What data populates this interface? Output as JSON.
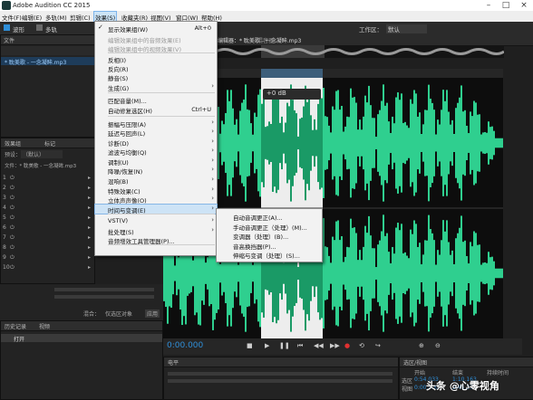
{
  "window": {
    "title": "Adobe Audition CC 2015"
  },
  "menubar": {
    "items": [
      "文件(F)",
      "编辑(E)",
      "多轨(M)",
      "剪辑(C)",
      "效果(S)",
      "收藏夹(R)",
      "视图(V)",
      "窗口(W)",
      "帮助(H)"
    ]
  },
  "toolbar": {
    "waveform": "波形",
    "multitrack": "多轨",
    "workspace_label": "工作区：",
    "workspace_value": "默认"
  },
  "files_panel": {
    "tab": "文件",
    "file_name": "* 耽美歌 - 一念凝眸.mp3"
  },
  "effects_panel": {
    "tab_rack": "效果组",
    "tab_markers": "标记",
    "preset_label": "预设：",
    "preset_value": "（默认）",
    "file_line": "文件：* 耽美歌 - 一念凝眸.mp3",
    "slot_numbers": [
      "1",
      "2",
      "3",
      "4",
      "5",
      "6",
      "7",
      "8",
      "9",
      "10"
    ]
  },
  "history_panel": {
    "tab": "历史记录",
    "tab2": "视频",
    "item": "打开"
  },
  "footer_left": {
    "mix_label": "混合：",
    "mix_value": "仅选区对象",
    "apply": "应用"
  },
  "editor": {
    "tab_label": "编辑器：* 耽美歌 - 一念凝眸.mp3",
    "mixer_tab": "混音器",
    "timecode": "0:00.000",
    "hud_gain": "+0 dB"
  },
  "levels_panel": {
    "tab": "电平"
  },
  "selection_panel": {
    "tab": "选区/视图",
    "col_start": "开始",
    "col_end": "结束",
    "col_duration": "持续时间",
    "row_sel": "选区",
    "row_view": "视图",
    "sel_start": "0:54.033",
    "view_start": "0:00.000",
    "sel_end": "1:10.163",
    "view_end": "2:45.375"
  },
  "effects_menu": {
    "items": [
      {
        "label": "显示效果组(W)",
        "shortcut": "Alt+0",
        "checked": true,
        "enabled": true
      },
      {
        "label": "编辑效果组中的音频效果(E)",
        "enabled": false
      },
      {
        "label": "编辑效果组中的视频效果(V)",
        "enabled": false
      },
      {
        "label": "反相(I)",
        "enabled": true
      },
      {
        "label": "反向(R)",
        "enabled": true
      },
      {
        "label": "静音(S)",
        "enabled": true
      },
      {
        "label": "生成(G)",
        "enabled": true,
        "submenu": true
      },
      {
        "label": "匹配音量(M)...",
        "enabled": true
      },
      {
        "label": "自动修复选区(H)",
        "shortcut": "Ctrl+U",
        "enabled": true
      },
      {
        "label": "振幅与压限(A)",
        "enabled": true,
        "submenu": true
      },
      {
        "label": "延迟与回声(L)",
        "enabled": true,
        "submenu": true
      },
      {
        "label": "诊断(D)",
        "enabled": true,
        "submenu": true
      },
      {
        "label": "滤波与均衡(Q)",
        "enabled": true,
        "submenu": true
      },
      {
        "label": "调制(U)",
        "enabled": true,
        "submenu": true
      },
      {
        "label": "降噪/恢复(N)",
        "enabled": true,
        "submenu": true
      },
      {
        "label": "混响(B)",
        "enabled": true,
        "submenu": true
      },
      {
        "label": "特殊效果(C)",
        "enabled": true,
        "submenu": true
      },
      {
        "label": "立体声声像(O)",
        "enabled": true,
        "submenu": true
      },
      {
        "label": "时间与变调(E)",
        "enabled": true,
        "submenu": true,
        "highlighted": true
      },
      {
        "label": "VST(V)",
        "enabled": true,
        "submenu": true
      },
      {
        "label": "批处理(S)",
        "enabled": true,
        "submenu": true
      },
      {
        "label": "音频增效工具管理器(P)...",
        "enabled": true
      }
    ]
  },
  "time_pitch_submenu": {
    "items": [
      {
        "label": "自动音调更正(A)...",
        "highlighted": false
      },
      {
        "label": "手动音调更正（处理）(M)...",
        "highlighted": false
      },
      {
        "label": "变调器（处理）(B)...",
        "highlighted": false
      },
      {
        "label": "音高换挡器(P)...",
        "highlighted": false
      },
      {
        "label": "伸缩与变调（处理）(S)...",
        "highlighted": true
      }
    ]
  },
  "colors": {
    "waveform": "#2fcf8f",
    "selection_bg": "#ededed",
    "accent_blue": "#2f8fd9",
    "menu_highlight": "#cde3f6"
  },
  "watermark": "头条 @心零视角"
}
